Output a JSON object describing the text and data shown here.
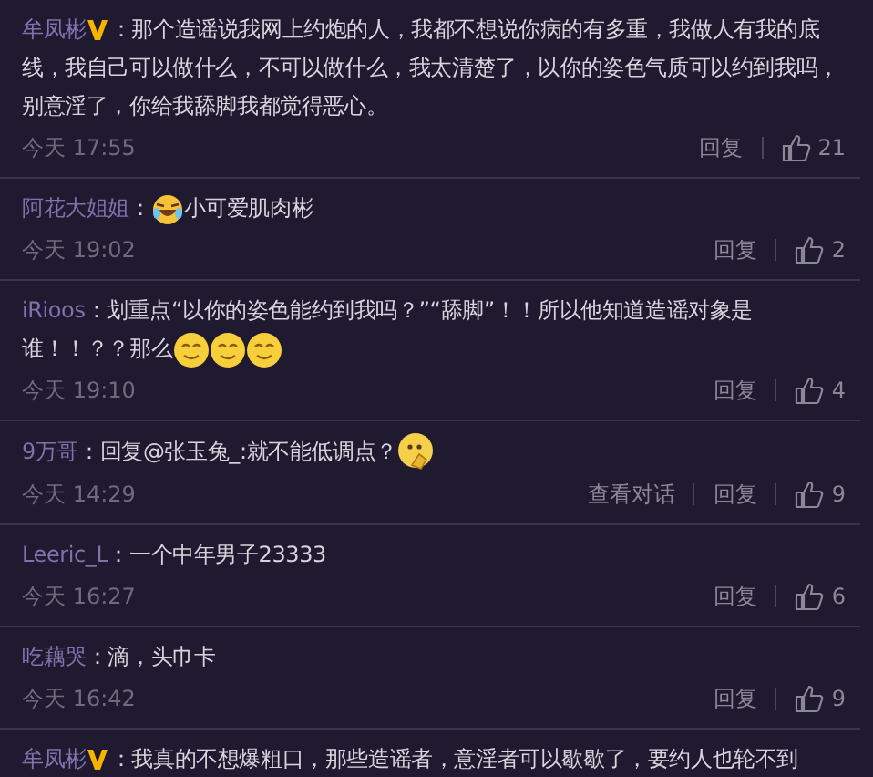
{
  "comments": [
    {
      "user": "牟凤彬",
      "verified": true,
      "parts": [
        {
          "kind": "text",
          "text": "：那个造谣说我网上约炮的人，我都不想说你病的有多重，我做人有我的底线，我自己可以做什么，不可以做什么，我太清楚了，以你的姿色气质可以约到我吗，别意淫了，你给我舔脚我都觉得恶心。"
        }
      ],
      "time": "今天 17:55",
      "actions": [
        "回复"
      ],
      "likes": "21"
    },
    {
      "user": "阿花大姐姐",
      "verified": false,
      "parts": [
        {
          "kind": "text",
          "text": "："
        },
        {
          "kind": "laugh"
        },
        {
          "kind": "text",
          "text": "小可爱肌肉彬"
        }
      ],
      "time": "今天 19:02",
      "actions": [
        "回复"
      ],
      "likes": "2"
    },
    {
      "user": "iRioos",
      "verified": false,
      "parts": [
        {
          "kind": "text",
          "text": "：划重点“以你的姿色能约到我吗？”“舔脚”！！所以他知道造谣对象是谁！！？？那么"
        },
        {
          "kind": "smile"
        },
        {
          "kind": "smile"
        },
        {
          "kind": "smile"
        }
      ],
      "time": "今天 19:10",
      "actions": [
        "回复"
      ],
      "likes": "4"
    },
    {
      "user": "9万哥",
      "verified": false,
      "parts": [
        {
          "kind": "text",
          "text": "：回复@张玉兔_:就不能低调点？"
        },
        {
          "kind": "think"
        }
      ],
      "time": "今天 14:29",
      "actions": [
        "查看对话",
        "回复"
      ],
      "likes": "9"
    },
    {
      "user": "Leeric_L",
      "verified": false,
      "parts": [
        {
          "kind": "text",
          "text": "：一个中年男子23333"
        }
      ],
      "time": "今天 16:27",
      "actions": [
        "回复"
      ],
      "likes": "6"
    },
    {
      "user": "吃藕哭",
      "verified": false,
      "parts": [
        {
          "kind": "text",
          "text": "：滴，头巾卡"
        }
      ],
      "time": "今天 16:42",
      "actions": [
        "回复"
      ],
      "likes": "9"
    },
    {
      "user": "牟凤彬",
      "verified": true,
      "parts": [
        {
          "kind": "text",
          "text": "：我真的不想爆粗口，那些造谣者，意淫者可以歇歇了，要约人也轮不到"
        }
      ]
    }
  ]
}
